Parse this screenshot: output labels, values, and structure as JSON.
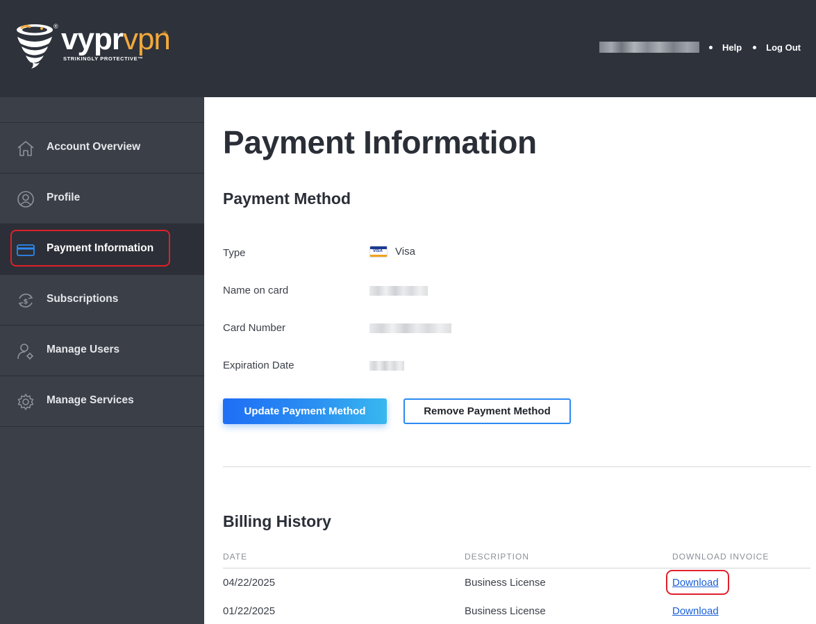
{
  "brand": {
    "name_part1": "vypr",
    "name_part2": "vpn",
    "registered": "®",
    "tagline": "STRIKINGLY PROTECTIVE™",
    "accent_color": "#f2a93b"
  },
  "header": {
    "help": "Help",
    "logout": "Log Out"
  },
  "sidebar": {
    "items": [
      {
        "label": "Account Overview",
        "icon": "home-icon"
      },
      {
        "label": "Profile",
        "icon": "user-circle-icon"
      },
      {
        "label": "Payment Information",
        "icon": "credit-card-icon",
        "active": true
      },
      {
        "label": "Subscriptions",
        "icon": "dollar-refresh-icon"
      },
      {
        "label": "Manage Users",
        "icon": "user-gear-icon"
      },
      {
        "label": "Manage Services",
        "icon": "gear-icon"
      }
    ]
  },
  "main": {
    "title": "Payment Information",
    "payment_method": {
      "heading": "Payment Method",
      "type_label": "Type",
      "type_value": "Visa",
      "name_label": "Name on card",
      "number_label": "Card Number",
      "expiration_label": "Expiration Date",
      "update_button": "Update Payment Method",
      "remove_button": "Remove Payment Method"
    },
    "billing": {
      "heading": "Billing History",
      "columns": [
        "DATE",
        "DESCRIPTION",
        "DOWNLOAD INVOICE"
      ],
      "rows": [
        {
          "date": "04/22/2025",
          "description": "Business License",
          "invoice": "Download"
        },
        {
          "date": "01/22/2025",
          "description": "Business License",
          "invoice": "Download"
        }
      ]
    }
  }
}
